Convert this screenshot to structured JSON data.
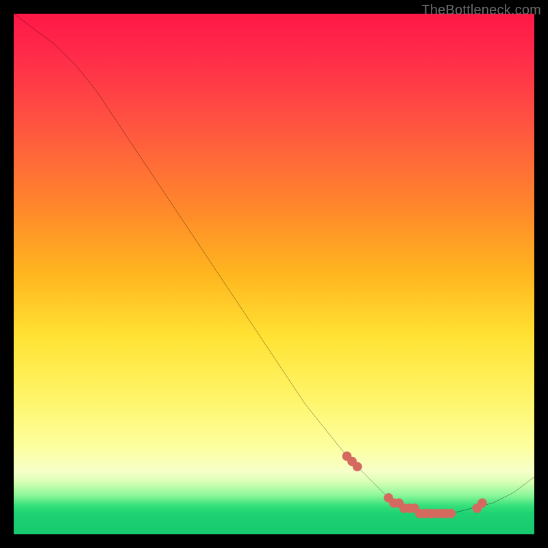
{
  "watermark": "TheBottleneck.com",
  "chart_data": {
    "type": "line",
    "title": "",
    "xlabel": "",
    "ylabel": "",
    "xlim": [
      0,
      100
    ],
    "ylim": [
      0,
      100
    ],
    "grid": false,
    "legend": false,
    "series": [
      {
        "name": "bottleneck-curve",
        "color": "#000000",
        "x": [
          0,
          4,
          8,
          12,
          16,
          20,
          24,
          28,
          32,
          36,
          40,
          44,
          48,
          52,
          56,
          60,
          64,
          68,
          72,
          76,
          80,
          84,
          88,
          92,
          96,
          100
        ],
        "y": [
          100,
          97,
          94,
          90,
          85,
          79,
          73,
          67,
          61,
          55,
          49,
          43,
          37,
          31,
          25,
          20,
          15,
          11,
          7,
          5,
          4,
          4,
          5,
          6,
          8,
          11
        ]
      }
    ],
    "markers": {
      "name": "highlight-points",
      "color": "#d46a5f",
      "x": [
        64,
        65,
        66,
        72,
        73,
        74,
        75,
        76,
        77,
        78,
        79,
        80,
        81,
        82,
        83,
        84,
        89,
        90
      ],
      "y": [
        15,
        14,
        13,
        7,
        6,
        6,
        5,
        5,
        5,
        4,
        4,
        4,
        4,
        4,
        4,
        4,
        5,
        6
      ]
    },
    "gradient_bands": [
      {
        "stop": 0.0,
        "color": "#ff1846"
      },
      {
        "stop": 0.22,
        "color": "#ff5640"
      },
      {
        "stop": 0.5,
        "color": "#ffb61f"
      },
      {
        "stop": 0.74,
        "color": "#fff56a"
      },
      {
        "stop": 0.9,
        "color": "#d6ffb3"
      },
      {
        "stop": 0.95,
        "color": "#35e07a"
      },
      {
        "stop": 1.0,
        "color": "#17c96f"
      }
    ]
  }
}
